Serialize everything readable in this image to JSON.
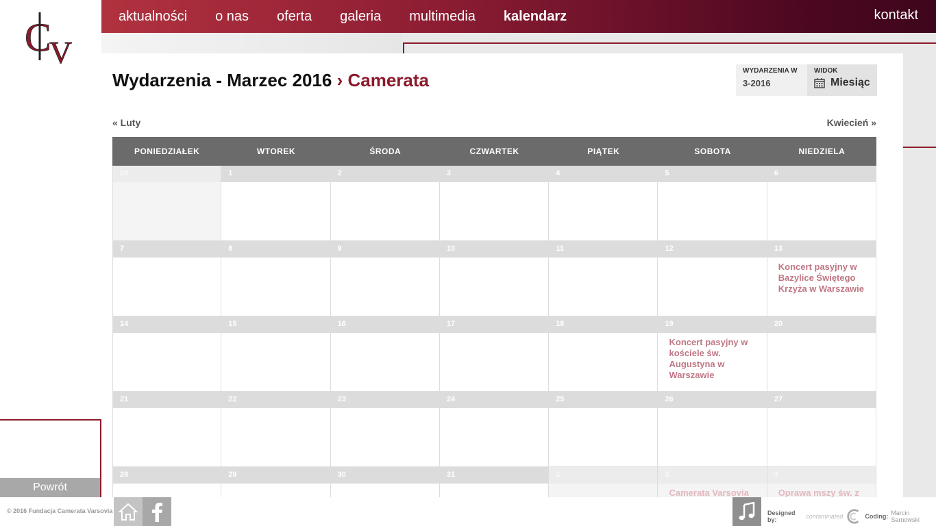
{
  "nav": {
    "items": [
      {
        "label": "aktualności"
      },
      {
        "label": "o nas"
      },
      {
        "label": "oferta"
      },
      {
        "label": "galeria"
      },
      {
        "label": "multimedia"
      },
      {
        "label": "kalendarz",
        "active": true
      }
    ],
    "contact": "kontakt"
  },
  "left": {
    "back": "Powrót"
  },
  "page": {
    "title": "Wydarzenia - Marzec 2016",
    "separator": "›",
    "category": "Camerata"
  },
  "filter": {
    "events_label": "WYDARZENIA W",
    "events_value": "3-2016",
    "view_label": "WIDOK",
    "view_value": "Miesiąc"
  },
  "pager": {
    "prev": "« Luty",
    "next": "Kwiecień »"
  },
  "calendar": {
    "weekdays": [
      "PONIEDZIAŁEK",
      "WTOREK",
      "ŚRODA",
      "CZWARTEK",
      "PIĄTEK",
      "SOBOTA",
      "NIEDZIELA"
    ],
    "weeks": [
      [
        {
          "n": "29",
          "other": true
        },
        {
          "n": "1"
        },
        {
          "n": "2"
        },
        {
          "n": "3"
        },
        {
          "n": "4"
        },
        {
          "n": "5"
        },
        {
          "n": "6"
        }
      ],
      [
        {
          "n": "7"
        },
        {
          "n": "8"
        },
        {
          "n": "9"
        },
        {
          "n": "10"
        },
        {
          "n": "11"
        },
        {
          "n": "12"
        },
        {
          "n": "13",
          "event": "Koncert pasyjny w Bazylice Świętego Krzyża w Warszawie"
        }
      ],
      [
        {
          "n": "14"
        },
        {
          "n": "15"
        },
        {
          "n": "16"
        },
        {
          "n": "17"
        },
        {
          "n": "18"
        },
        {
          "n": "19",
          "event": "Koncert pasyjny w kościele św. Augustyna w Warszawie"
        },
        {
          "n": "20"
        }
      ],
      [
        {
          "n": "21"
        },
        {
          "n": "22"
        },
        {
          "n": "23"
        },
        {
          "n": "24"
        },
        {
          "n": "25"
        },
        {
          "n": "26"
        },
        {
          "n": "27"
        }
      ],
      [
        {
          "n": "28"
        },
        {
          "n": "29"
        },
        {
          "n": "30"
        },
        {
          "n": "31"
        },
        {
          "n": "1",
          "other": true
        },
        {
          "n": "2",
          "other": true,
          "event": "Camerata Varsovia"
        },
        {
          "n": "3",
          "other": true,
          "event": "Oprawa mszy św. z"
        }
      ]
    ]
  },
  "footer": {
    "copyright": "© 2016 Fundacja Camerata Varsovia",
    "designed_by": "Designed by:",
    "designer": "contaminated",
    "coding_label": "Coding:",
    "coder": "Marcin Sarnowski"
  },
  "colors": {
    "accent": "#8c1a2c",
    "event": "#c07784"
  }
}
